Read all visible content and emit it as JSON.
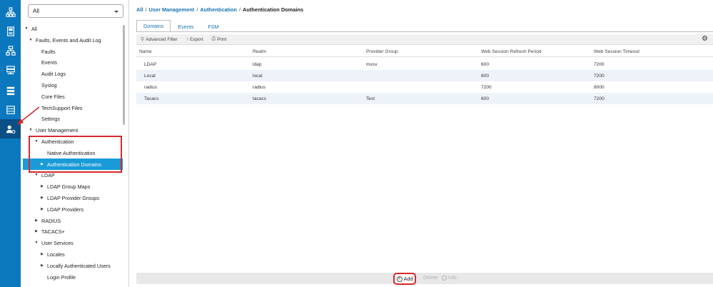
{
  "rail": {
    "items": [
      {
        "icon": "network-topology-icon"
      },
      {
        "icon": "server-chassis-icon"
      },
      {
        "icon": "lan-tree-icon"
      },
      {
        "icon": "storage-stack-icon"
      },
      {
        "icon": "list-rows-icon"
      },
      {
        "icon": "table-grid-icon"
      },
      {
        "icon": "admin-user-gear-icon",
        "active": true
      }
    ]
  },
  "nav": {
    "filter_value": "All",
    "tree": [
      {
        "label": "All",
        "level": 0,
        "toggle": "down"
      },
      {
        "label": "Faults, Events and Audit Log",
        "level": 1,
        "toggle": "down"
      },
      {
        "label": "Faults",
        "level": 2,
        "toggle": ""
      },
      {
        "label": "Events",
        "level": 2,
        "toggle": ""
      },
      {
        "label": "Audit Logs",
        "level": 2,
        "toggle": ""
      },
      {
        "label": "Syslog",
        "level": 2,
        "toggle": ""
      },
      {
        "label": "Core Files",
        "level": 2,
        "toggle": ""
      },
      {
        "label": "TechSupport Files",
        "level": 2,
        "toggle": ""
      },
      {
        "label": "Settings",
        "level": 2,
        "toggle": ""
      },
      {
        "label": "User Management",
        "level": 1,
        "toggle": "down"
      },
      {
        "label": "Authentication",
        "level": 2,
        "toggle": "down"
      },
      {
        "label": "Native Authentication",
        "level": 3,
        "toggle": ""
      },
      {
        "label": "Authentication Domains",
        "level": 3,
        "toggle": "right",
        "selected": true
      },
      {
        "label": "LDAP",
        "level": 2,
        "toggle": "down"
      },
      {
        "label": "LDAP Group Maps",
        "level": 3,
        "toggle": "right"
      },
      {
        "label": "LDAP Provider Groups",
        "level": 3,
        "toggle": "right"
      },
      {
        "label": "LDAP Providers",
        "level": 3,
        "toggle": "right"
      },
      {
        "label": "RADIUS",
        "level": 2,
        "toggle": "right"
      },
      {
        "label": "TACACS+",
        "level": 2,
        "toggle": "right"
      },
      {
        "label": "User Services",
        "level": 2,
        "toggle": "down"
      },
      {
        "label": "Locales",
        "level": 3,
        "toggle": "right"
      },
      {
        "label": "Locally Authenticated Users",
        "level": 3,
        "toggle": "right"
      },
      {
        "label": "Login Profile",
        "level": 3,
        "toggle": ""
      }
    ]
  },
  "breadcrumb": {
    "items": [
      "All",
      "User Management",
      "Authentication"
    ],
    "current": "Authentication Domains",
    "separator": "/"
  },
  "tabs": [
    {
      "label": "Domains",
      "active": true
    },
    {
      "label": "Events",
      "active": false
    },
    {
      "label": "FSM",
      "active": false
    }
  ],
  "toolbar": {
    "filter_label": "Advanced Filter",
    "export_label": "Export",
    "print_label": "Print"
  },
  "table": {
    "columns": [
      "Name",
      "Realm",
      "Provider Group",
      "Web Session Refresh Period",
      "Web Session Timeout"
    ],
    "rows": [
      [
        "LDAP",
        "ldap",
        "mxsv",
        "600",
        "7200"
      ],
      [
        "Local",
        "local",
        "",
        "600",
        "7200"
      ],
      [
        "radius",
        "radius",
        "",
        "7200",
        "8000"
      ],
      [
        "Tacacs",
        "tacacs",
        "Test",
        "600",
        "7200"
      ]
    ]
  },
  "footer": {
    "add_label": "Add",
    "delete_label": "Delete",
    "info_label": "Info"
  },
  "colors": {
    "rail_bg": "#0b77bd",
    "selected_bg": "#1a9bd7",
    "annotation_red": "#d9282b",
    "link_blue": "#1673b5"
  }
}
